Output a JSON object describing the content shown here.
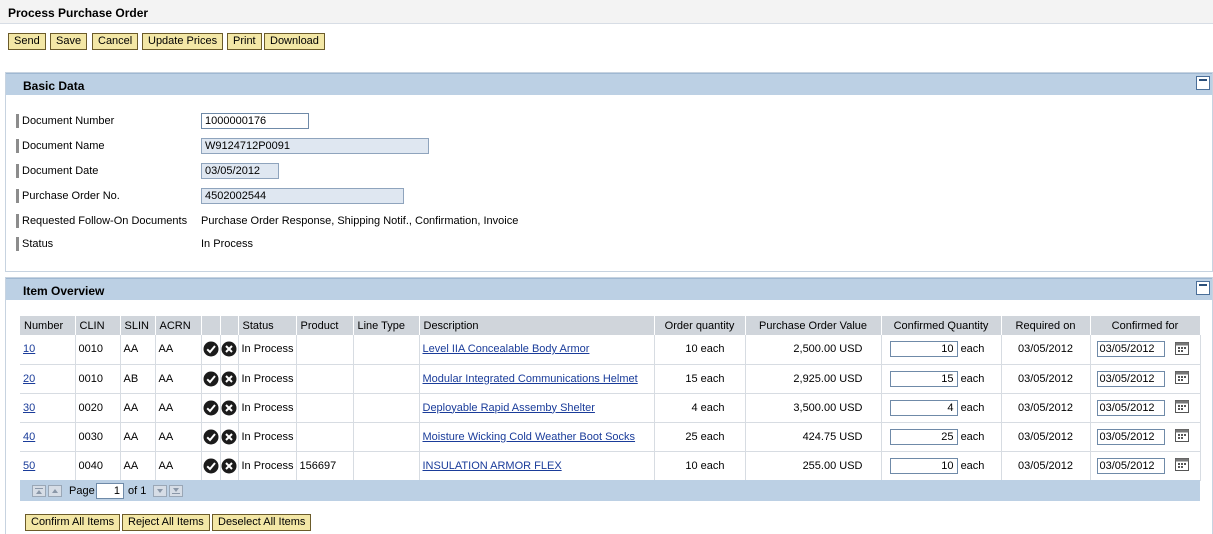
{
  "page": {
    "title": "Process Purchase Order"
  },
  "toolbar": {
    "send": "Send",
    "save": "Save",
    "cancel": "Cancel",
    "update_prices": "Update Prices",
    "print": "Print",
    "download": "Download"
  },
  "basic_data": {
    "title": "Basic Data",
    "fields": {
      "document_number": {
        "label": "Document Number",
        "value": "1000000176"
      },
      "document_name": {
        "label": "Document Name",
        "value": "W9124712P0091"
      },
      "document_date": {
        "label": "Document Date",
        "value": "03/05/2012"
      },
      "po_number": {
        "label": "Purchase Order No.",
        "value": "4502002544"
      },
      "follow_on": {
        "label": "Requested Follow-On Documents",
        "value": "Purchase Order Response, Shipping Notif., Confirmation, Invoice"
      },
      "status": {
        "label": "Status",
        "value": "In Process"
      }
    }
  },
  "item_overview": {
    "title": "Item Overview",
    "columns": {
      "number": "Number",
      "clin": "CLIN",
      "slin": "SLIN",
      "acrn": "ACRN",
      "status": "Status",
      "product": "Product",
      "line_type": "Line Type",
      "description": "Description",
      "order_qty": "Order quantity",
      "po_value": "Purchase Order Value",
      "confirmed_qty": "Confirmed Quantity",
      "required_on": "Required on",
      "confirmed_for": "Confirmed for"
    },
    "rows": [
      {
        "number": "10",
        "clin": "0010",
        "slin": "AA",
        "acrn": "AA",
        "status": "In Process",
        "product": "",
        "line_type": "",
        "description": "Level IIA Concealable Body Armor",
        "order_qty": "10 each",
        "po_value": "2,500.00 USD",
        "confirmed_qty": "10",
        "confirmed_unit": "each",
        "required_on": "03/05/2012",
        "confirmed_for": "03/05/2012"
      },
      {
        "number": "20",
        "clin": "0010",
        "slin": "AB",
        "acrn": "AA",
        "status": "In Process",
        "product": "",
        "line_type": "",
        "description": "Modular Integrated Communications Helmet",
        "order_qty": "15 each",
        "po_value": "2,925.00 USD",
        "confirmed_qty": "15",
        "confirmed_unit": "each",
        "required_on": "03/05/2012",
        "confirmed_for": "03/05/2012"
      },
      {
        "number": "30",
        "clin": "0020",
        "slin": "AA",
        "acrn": "AA",
        "status": "In Process",
        "product": "",
        "line_type": "",
        "description": "Deployable Rapid Assemby Shelter",
        "order_qty": "4 each",
        "po_value": "3,500.00 USD",
        "confirmed_qty": "4",
        "confirmed_unit": "each",
        "required_on": "03/05/2012",
        "confirmed_for": "03/05/2012"
      },
      {
        "number": "40",
        "clin": "0030",
        "slin": "AA",
        "acrn": "AA",
        "status": "In Process",
        "product": "",
        "line_type": "",
        "description": "Moisture Wicking Cold Weather Boot Socks",
        "order_qty": "25 each",
        "po_value": "424.75 USD",
        "confirmed_qty": "25",
        "confirmed_unit": "each",
        "required_on": "03/05/2012",
        "confirmed_for": "03/05/2012"
      },
      {
        "number": "50",
        "clin": "0040",
        "slin": "AA",
        "acrn": "AA",
        "status": "In Process",
        "product": "156697",
        "line_type": "",
        "description": "INSULATION ARMOR FLEX",
        "order_qty": "10 each",
        "po_value": "255.00 USD",
        "confirmed_qty": "10",
        "confirmed_unit": "each",
        "required_on": "03/05/2012",
        "confirmed_for": "03/05/2012"
      }
    ],
    "pager": {
      "page_label": "Page",
      "page_value": "1",
      "of_label": "of 1"
    }
  },
  "bottom_actions": {
    "confirm_all": "Confirm All Items",
    "reject_all": "Reject All Items",
    "deselect_all": "Deselect All Items"
  },
  "icons": {
    "accept": "check-circle-icon",
    "reject": "x-circle-icon",
    "calendar": "calendar-icon",
    "collapse": "collapse-icon",
    "first_page": "first-page-icon",
    "prev_page": "prev-page-icon",
    "next_page": "next-page-icon",
    "last_page": "last-page-icon"
  },
  "colors": {
    "section_header": "#bcd0e4",
    "button_bg": "#f3e7a6",
    "link": "#1a3c9a"
  }
}
